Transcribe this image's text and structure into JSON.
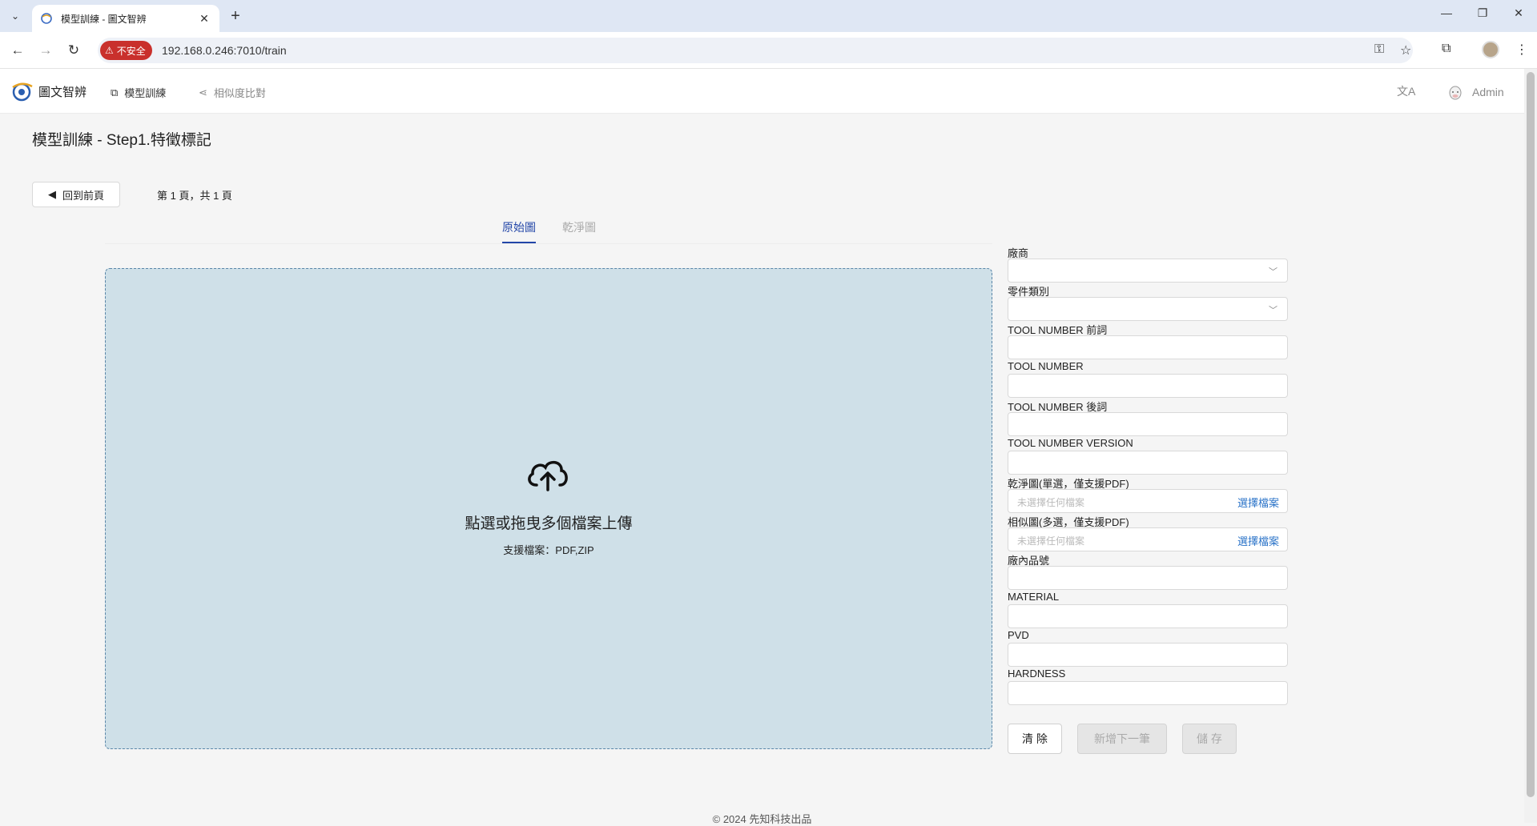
{
  "browser": {
    "tab_title": "模型訓練 - 圖文智辨",
    "new_tab": "+",
    "insecure_label": "不安全",
    "url": "192.168.0.246:7010/train"
  },
  "header": {
    "logo_text": "圖文智辨",
    "nav": [
      {
        "label": "模型訓練"
      },
      {
        "label": "相似度比對"
      }
    ],
    "user": "Admin"
  },
  "page": {
    "title": "模型訓練 - Step1.特徵標記",
    "back_label": "回到前頁",
    "pager": "第 1 頁，共 1 頁",
    "tabs": [
      {
        "label": "原始圖",
        "active": true
      },
      {
        "label": "乾淨圖",
        "active": false
      }
    ]
  },
  "upload": {
    "text": "點選或拖曳多個檔案上傳",
    "sub": "支援檔案：PDF,ZIP"
  },
  "form": {
    "fields": [
      {
        "label": "廠商",
        "type": "select",
        "value": ""
      },
      {
        "label": "零件類別",
        "type": "select",
        "value": ""
      },
      {
        "label": "TOOL NUMBER 前詞",
        "type": "text",
        "value": ""
      },
      {
        "label": "TOOL NUMBER",
        "type": "text",
        "value": ""
      },
      {
        "label": "TOOL NUMBER 後詞",
        "type": "text",
        "value": ""
      },
      {
        "label": "TOOL NUMBER VERSION",
        "type": "text",
        "value": ""
      },
      {
        "label": "乾淨圖(單選，僅支援PDF)",
        "type": "file",
        "placeholder": "未選擇任何檔案",
        "button": "選擇檔案"
      },
      {
        "label": "相似圖(多選，僅支援PDF)",
        "type": "file",
        "placeholder": "未選擇任何檔案",
        "button": "選擇檔案"
      },
      {
        "label": "廠內品號",
        "type": "text",
        "value": ""
      },
      {
        "label": "MATERIAL",
        "type": "text",
        "value": ""
      },
      {
        "label": "PVD",
        "type": "text",
        "value": ""
      },
      {
        "label": "HARDNESS",
        "type": "text",
        "value": ""
      }
    ],
    "buttons": {
      "clear": "清 除",
      "add_next": "新增下一筆",
      "save": "儲 存"
    }
  },
  "footer": "© 2024 先知科技出品",
  "colors": {
    "accent": "#2346a8",
    "dropzone": "#cfe0e8",
    "insecure": "#c9302c",
    "link": "#2a73c8"
  }
}
